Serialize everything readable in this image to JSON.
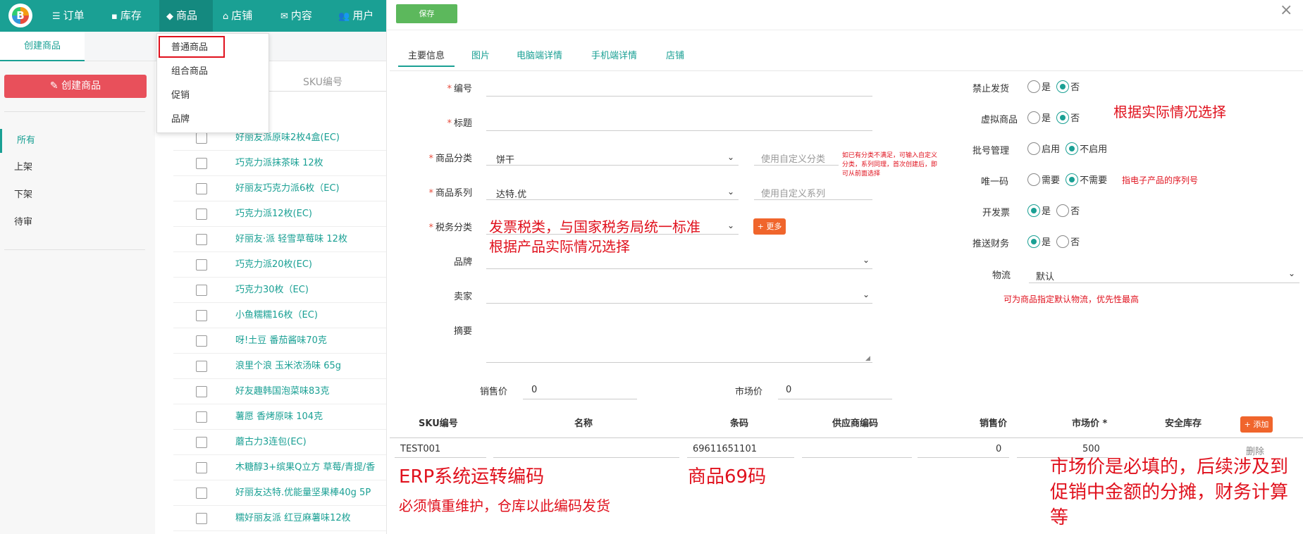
{
  "nav": {
    "logo_letter": "B",
    "items": [
      {
        "label": "订单",
        "icon": "list-icon"
      },
      {
        "label": "库存",
        "icon": "box-icon"
      },
      {
        "label": "商品",
        "icon": "layers-icon"
      },
      {
        "label": "店铺",
        "icon": "store-icon"
      },
      {
        "label": "内容",
        "icon": "message-icon"
      },
      {
        "label": "用户",
        "icon": "users-icon"
      }
    ]
  },
  "left_tab": "创建商品",
  "sidebar": {
    "create_button": "创建商品",
    "items": [
      "所有",
      "上架",
      "下架",
      "待审"
    ]
  },
  "dropdown": {
    "items": [
      "普通商品",
      "组合商品",
      "促销",
      "品牌"
    ]
  },
  "list": {
    "search_placeholder": "SKU编号",
    "rows": [
      "好丽友派原味2枚4盒(EC)",
      "巧克力派抹茶味 12枚",
      "好丽友巧克力派6枚（EC)",
      "巧克力派12枚(EC)",
      "好丽友·派 轻雪草莓味 12枚",
      "巧克力派20枚(EC)",
      "巧克力30枚（EC)",
      "小鱼糯糯16枚（EC)",
      "呀!土豆 番茄酱味70克",
      "浪里个浪 玉米浓汤味 65g",
      "好友趣韩国泡菜味83克",
      "薯愿 香烤原味 104克",
      "蘑古力3连包(EC)",
      "木糖醇3+缤果Q立方 草莓/青提/香",
      "好丽友达特.优能量坚果棒40g 5P",
      "糯好丽友派 红豆麻薯味12枚"
    ]
  },
  "modal": {
    "save_label": "保存",
    "close_label": "×",
    "tabs": [
      "主要信息",
      "图片",
      "电脑端详情",
      "手机端详情",
      "店铺"
    ],
    "fields": {
      "code_label": "编号",
      "title_label": "标题",
      "category_label": "商品分类",
      "category_value": "饼干",
      "category_custom_ph": "使用自定义分类",
      "category_hint": "如已有分类不满足，可输入自定义分类，系列同理，首次创建后，即可从前面选择",
      "series_label": "商品系列",
      "series_value": "达特.优",
      "series_custom_ph": "使用自定义系列",
      "tax_label": "税务分类",
      "more_label": "+ 更多",
      "brand_label": "品牌",
      "seller_label": "卖家",
      "summary_label": "摘要",
      "sale_price_label": "销售价",
      "sale_price_value": "0",
      "market_price_label": "市场价",
      "market_price_value": "0"
    },
    "right": {
      "forbid_ship_label": "禁止发货",
      "virtual_label": "虚拟商品",
      "batch_label": "批号管理",
      "unique_label": "唯一码",
      "invoice_label": "开发票",
      "push_finance_label": "推送财务",
      "logistics_label": "物流",
      "logistics_value": "默认",
      "yes": "是",
      "no": "否",
      "enable": "启用",
      "disable": "不启用",
      "need": "需要",
      "no_need": "不需要"
    },
    "annotations": {
      "choose_actual": "根据实际情况选择",
      "serial_hint": "指电子产品的序列号",
      "logistics_hint": "可为商品指定默认物流，优先性最高",
      "tax_line1": "发票税类，与国家税务局统一标准",
      "tax_line2": "根据产品实际情况选择",
      "erp_title": "ERP系统运转编码",
      "erp_sub": "必须慎重维护，仓库以此编码发货",
      "barcode_note": "商品69码",
      "market_note_1": "市场价是必填的，后续涉及到",
      "market_note_2": "促销中金额的分摊，财务计算",
      "market_note_3": "等"
    },
    "sku_table": {
      "headers": [
        "SKU编号",
        "名称",
        "条码",
        "供应商编码",
        "销售价",
        "市场价 *",
        "安全库存"
      ],
      "add_label": "+ 添加",
      "row": {
        "sku": "TEST001",
        "name": "",
        "barcode": "69611651101",
        "supplier": "",
        "sale": "0",
        "market": "500",
        "stock": "",
        "delete": "删除"
      }
    }
  }
}
